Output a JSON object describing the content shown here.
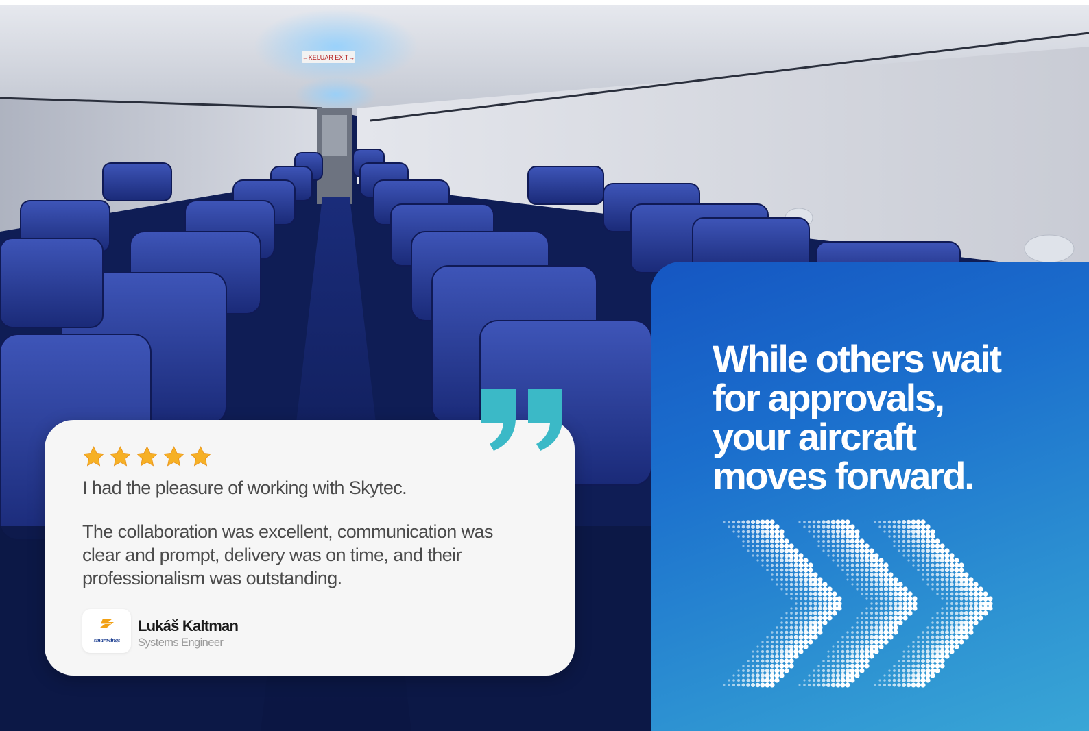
{
  "testimonial": {
    "rating": 5,
    "line1": "I had the pleasure of working with Skytec.",
    "line2": "The collaboration was excellent, communication was clear and prompt, delivery was on time, and their professionalism was outstanding.",
    "author": {
      "name": "Lukáš Kaltman",
      "role": "Systems Engineer",
      "logo_text": "smartwings"
    }
  },
  "headline": {
    "line1": "While others wait",
    "line2": "for approvals,",
    "line3": "your aircraft",
    "line4": "moves forward."
  },
  "cabin_sign": "←KELUAR  EXIT→",
  "icons": {
    "stars": "star-icon",
    "quote": "closing-quote-icon",
    "arrows": "dotted-chevron-arrows-icon"
  },
  "colors": {
    "panel_start": "#1556c2",
    "panel_end": "#39a6d6",
    "quote_mark": "#3bb9c7",
    "star": "#f6b025",
    "card": "#f6f6f6",
    "headline": "#ffffff"
  }
}
